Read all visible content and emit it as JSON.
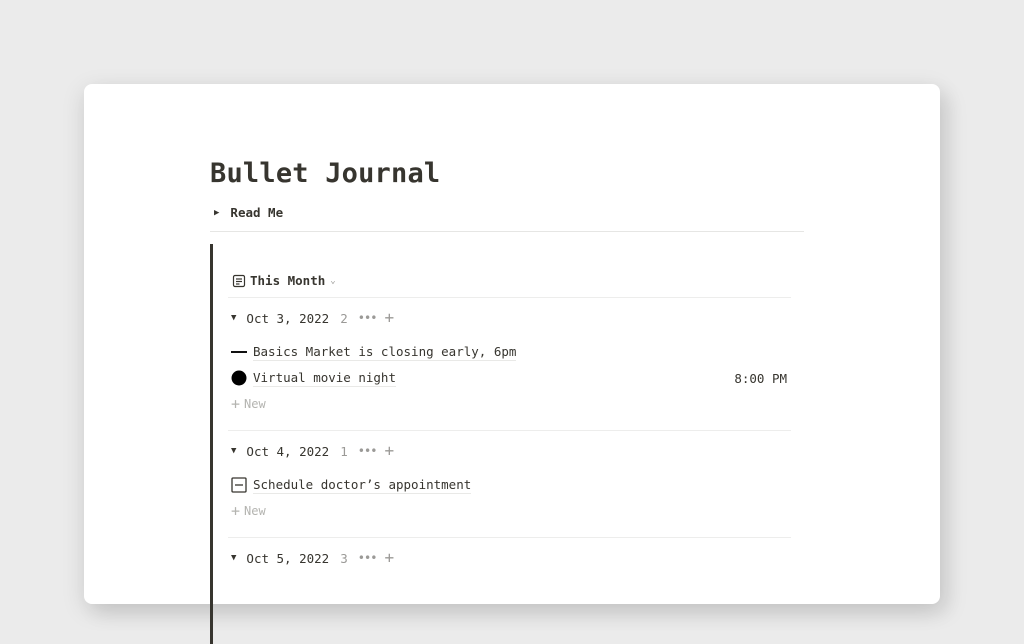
{
  "page": {
    "title": "Bullet Journal",
    "readme_toggle": {
      "icon": "triangle-right-icon",
      "label": "Read Me"
    }
  },
  "view": {
    "icon": "list-view-icon",
    "label": "This Month",
    "dropdown_icon": "chevron-down-icon"
  },
  "groups": [
    {
      "date": "Oct 3, 2022",
      "count": "2",
      "items": [
        {
          "type": "note",
          "bullet_icon": "dash-icon",
          "text": "Basics Market is closing early, 6pm",
          "time": ""
        },
        {
          "type": "event",
          "bullet_icon": "filled-circle-icon",
          "text": "Virtual movie night",
          "time": "8:00 PM"
        }
      ],
      "new_label": "New"
    },
    {
      "date": "Oct 4, 2022",
      "count": "1",
      "items": [
        {
          "type": "task",
          "bullet_icon": "boxed-dash-icon",
          "text": "Schedule doctor’s appointment",
          "time": ""
        }
      ],
      "new_label": "New"
    },
    {
      "date": "Oct 5, 2022",
      "count": "3",
      "items": [],
      "new_label": ""
    }
  ],
  "glyphs": {
    "toggle_open": "▼",
    "toggle_closed": "▶",
    "more": "•••",
    "plus": "+",
    "chevron": "⌄"
  }
}
